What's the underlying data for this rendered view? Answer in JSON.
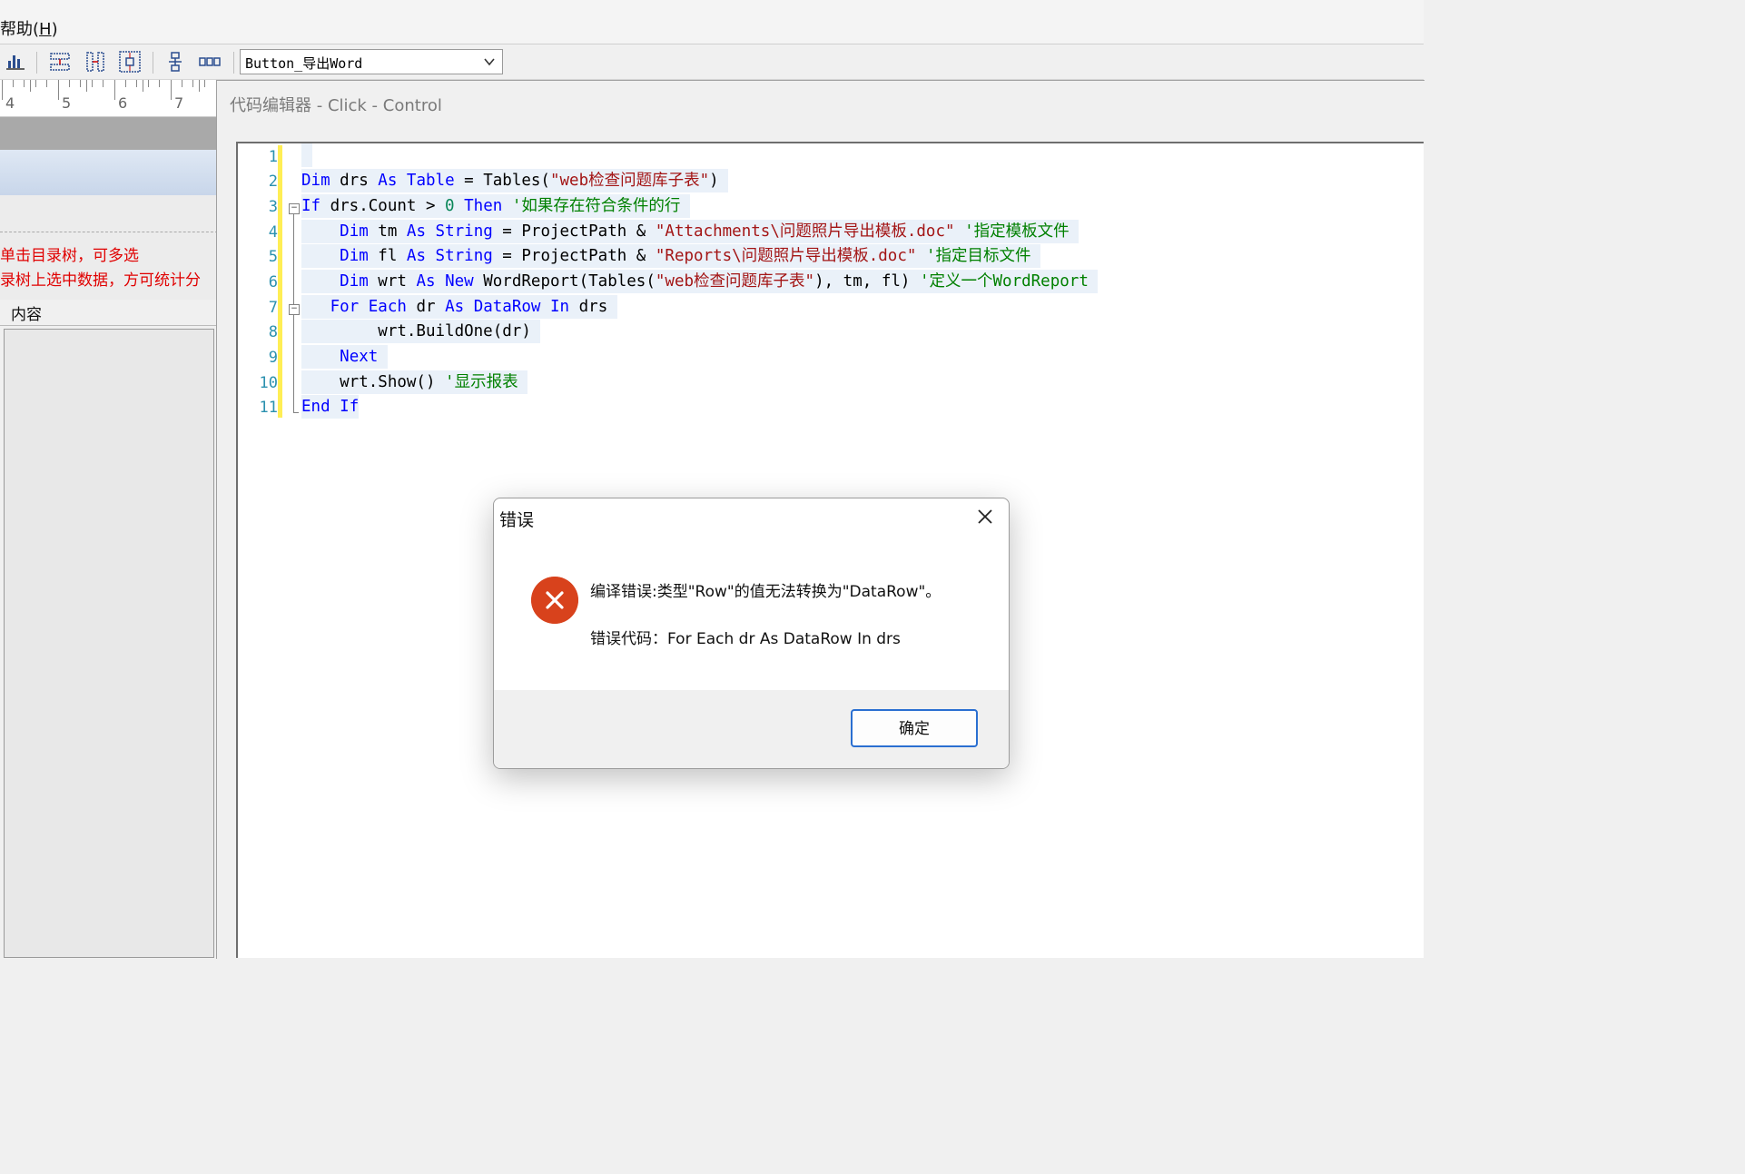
{
  "menu": {
    "help_label": "帮助(",
    "help_key": "H",
    "help_close": ")"
  },
  "toolbar": {
    "object_combo_value": "Button_导出Word"
  },
  "ruler": {
    "marks": [
      "4",
      "5",
      "6",
      "7"
    ]
  },
  "left_panel": {
    "hint_line1": "单击目录树，可多选",
    "hint_line2": "录树上选中数据，方可统计分",
    "column_header": "内容"
  },
  "editor": {
    "title": "代码编辑器 - Click - Control",
    "line_numbers": [
      "1",
      "2",
      "3",
      "4",
      "5",
      "6",
      "7",
      "8",
      "9",
      "10",
      "11"
    ]
  },
  "dialog": {
    "title": "错误",
    "message": "编译错误:类型\"Row\"的值无法转换为\"DataRow\"。",
    "error_code": "错误代码：For Each dr As DataRow In drs",
    "ok_label": "确定"
  },
  "colors": {
    "keyword": "#0000ff",
    "string": "#a31515",
    "comment": "#008000",
    "error": "#d8421c",
    "accent": "#2a6fd1"
  }
}
